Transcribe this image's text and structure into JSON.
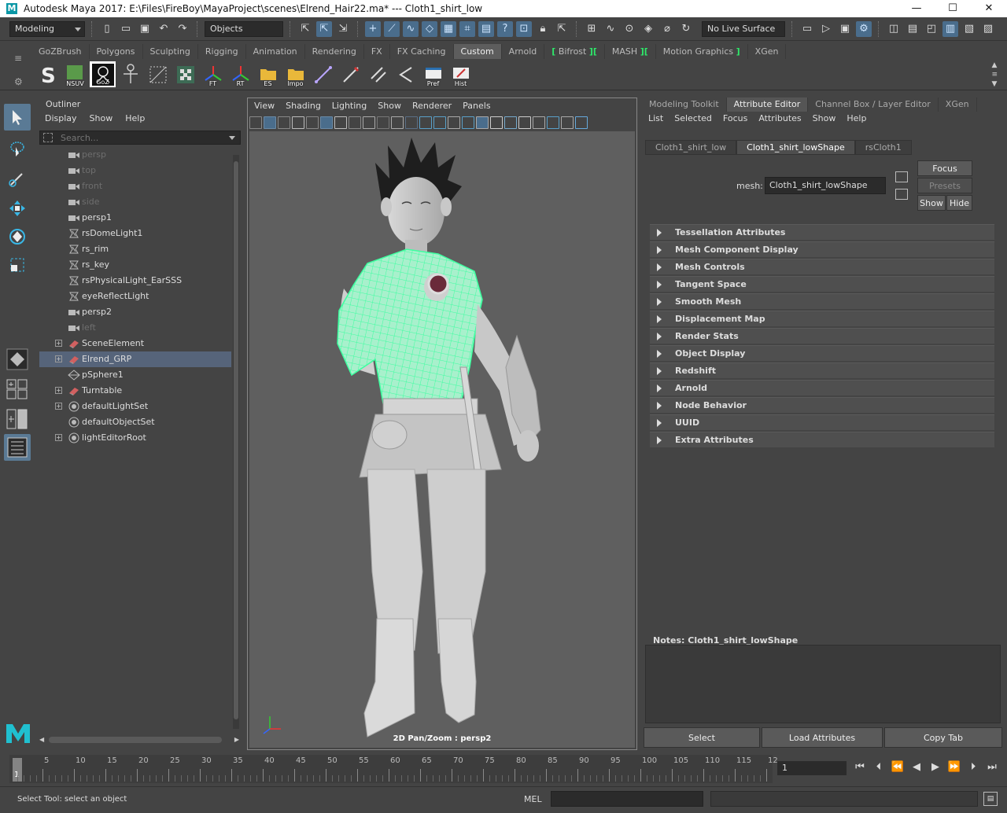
{
  "window": {
    "title": "Autodesk Maya 2017: E:\\Files\\FireBoy\\MayaProject\\scenes\\Elrend_Hair22.ma*   ---   Cloth1_shirt_low",
    "minimize": "—",
    "maximize": "☐",
    "close": "✕"
  },
  "statusline": {
    "menuset": "Modeling",
    "selection_mask": "Objects",
    "live_surface": "No Live Surface"
  },
  "shelf": {
    "tabs": [
      "GoZBrush",
      "Polygons",
      "Sculpting",
      "Rigging",
      "Animation",
      "Rendering",
      "FX",
      "FX Caching",
      "Custom",
      "Arnold",
      "Bifrost",
      "MASH",
      "Motion Graphics",
      "XGen"
    ],
    "active_tab": "Custom",
    "buttons": [
      {
        "label": "",
        "icon": "s-icon"
      },
      {
        "label": "NSUV",
        "icon": "nsuv-icon"
      },
      {
        "label": "GoZ",
        "icon": "goz-icon"
      },
      {
        "label": "",
        "icon": "joint-icon"
      },
      {
        "label": "",
        "icon": "bbox-icon"
      },
      {
        "label": "",
        "icon": "checker-icon"
      },
      {
        "label": "FT",
        "icon": "axis-icon"
      },
      {
        "label": "RT",
        "icon": "axis-icon"
      },
      {
        "label": "ES",
        "icon": "folder-icon"
      },
      {
        "label": "Impo",
        "icon": "folder-icon"
      },
      {
        "label": "",
        "icon": "curve-icon"
      },
      {
        "label": "",
        "icon": "pen-icon"
      },
      {
        "label": "",
        "icon": "arrow-icon"
      },
      {
        "label": "",
        "icon": "arrow-left-icon"
      },
      {
        "label": "Pref",
        "icon": "window-icon"
      },
      {
        "label": "Hist",
        "icon": "history-icon"
      }
    ]
  },
  "outliner": {
    "title": "Outliner",
    "menu": [
      "Display",
      "Show",
      "Help"
    ],
    "search_placeholder": "Search...",
    "items": [
      {
        "label": "persp",
        "icon": "camera",
        "dim": true,
        "expand": ""
      },
      {
        "label": "top",
        "icon": "camera",
        "dim": true,
        "expand": ""
      },
      {
        "label": "front",
        "icon": "camera",
        "dim": true,
        "expand": ""
      },
      {
        "label": "side",
        "icon": "camera",
        "dim": true,
        "expand": ""
      },
      {
        "label": "persp1",
        "icon": "camera",
        "dim": false,
        "expand": ""
      },
      {
        "label": "rsDomeLight1",
        "icon": "light",
        "dim": false,
        "expand": ""
      },
      {
        "label": "rs_rim",
        "icon": "light",
        "dim": false,
        "expand": ""
      },
      {
        "label": "rs_key",
        "icon": "light",
        "dim": false,
        "expand": ""
      },
      {
        "label": "rsPhysicalLight_EarSSS",
        "icon": "light",
        "dim": false,
        "expand": ""
      },
      {
        "label": "eyeReflectLight",
        "icon": "light",
        "dim": false,
        "expand": ""
      },
      {
        "label": "persp2",
        "icon": "camera",
        "dim": false,
        "expand": ""
      },
      {
        "label": "left",
        "icon": "camera",
        "dim": true,
        "expand": ""
      },
      {
        "label": "SceneElement",
        "icon": "group",
        "dim": false,
        "expand": "+"
      },
      {
        "label": "Elrend_GRP",
        "icon": "group",
        "dim": false,
        "expand": "+",
        "selected": true
      },
      {
        "label": "pSphere1",
        "icon": "mesh",
        "dim": false,
        "expand": ""
      },
      {
        "label": "Turntable",
        "icon": "group",
        "dim": false,
        "expand": "+"
      },
      {
        "label": "defaultLightSet",
        "icon": "set",
        "dim": false,
        "expand": "+"
      },
      {
        "label": "defaultObjectSet",
        "icon": "set",
        "dim": false,
        "expand": ""
      },
      {
        "label": "lightEditorRoot",
        "icon": "set",
        "dim": false,
        "expand": "+"
      }
    ]
  },
  "viewport": {
    "menu": [
      "View",
      "Shading",
      "Lighting",
      "Show",
      "Renderer",
      "Panels"
    ],
    "hud_label": "2D Pan/Zoom : persp2",
    "selection_color": "#3dffa0"
  },
  "attribute_editor": {
    "tabs": [
      "Modeling Toolkit",
      "Attribute Editor",
      "Channel Box / Layer Editor",
      "XGen"
    ],
    "active_tab": "Attribute Editor",
    "menu": [
      "List",
      "Selected",
      "Focus",
      "Attributes",
      "Show",
      "Help"
    ],
    "node_tabs": [
      "Cloth1_shirt_low",
      "Cloth1_shirt_lowShape",
      "rsCloth1"
    ],
    "active_node_tab": "Cloth1_shirt_lowShape",
    "mesh_label": "mesh:",
    "mesh_value": "Cloth1_shirt_lowShape",
    "focus_btn": "Focus",
    "presets_btn": "Presets",
    "show_btn": "Show",
    "hide_btn": "Hide",
    "sections": [
      "Tessellation Attributes",
      "Mesh Component Display",
      "Mesh Controls",
      "Tangent Space",
      "Smooth Mesh",
      "Displacement Map",
      "Render Stats",
      "Object Display",
      "Redshift",
      "Arnold",
      "Node Behavior",
      "UUID",
      "Extra Attributes"
    ],
    "notes_label": "Notes:  Cloth1_shirt_lowShape",
    "select_btn": "Select",
    "load_btn": "Load Attributes",
    "copy_btn": "Copy Tab"
  },
  "timeslider": {
    "labels": [
      "5",
      "10",
      "15",
      "20",
      "25",
      "30",
      "35",
      "40",
      "45",
      "50",
      "55",
      "60",
      "65",
      "70",
      "75",
      "80",
      "85",
      "90",
      "95",
      "100",
      "105",
      "110",
      "115",
      "12"
    ],
    "current_frame_marker": "1",
    "current_frame_field": "1"
  },
  "commandline": {
    "help_text": "Select Tool: select an object",
    "mel_label": "MEL"
  }
}
